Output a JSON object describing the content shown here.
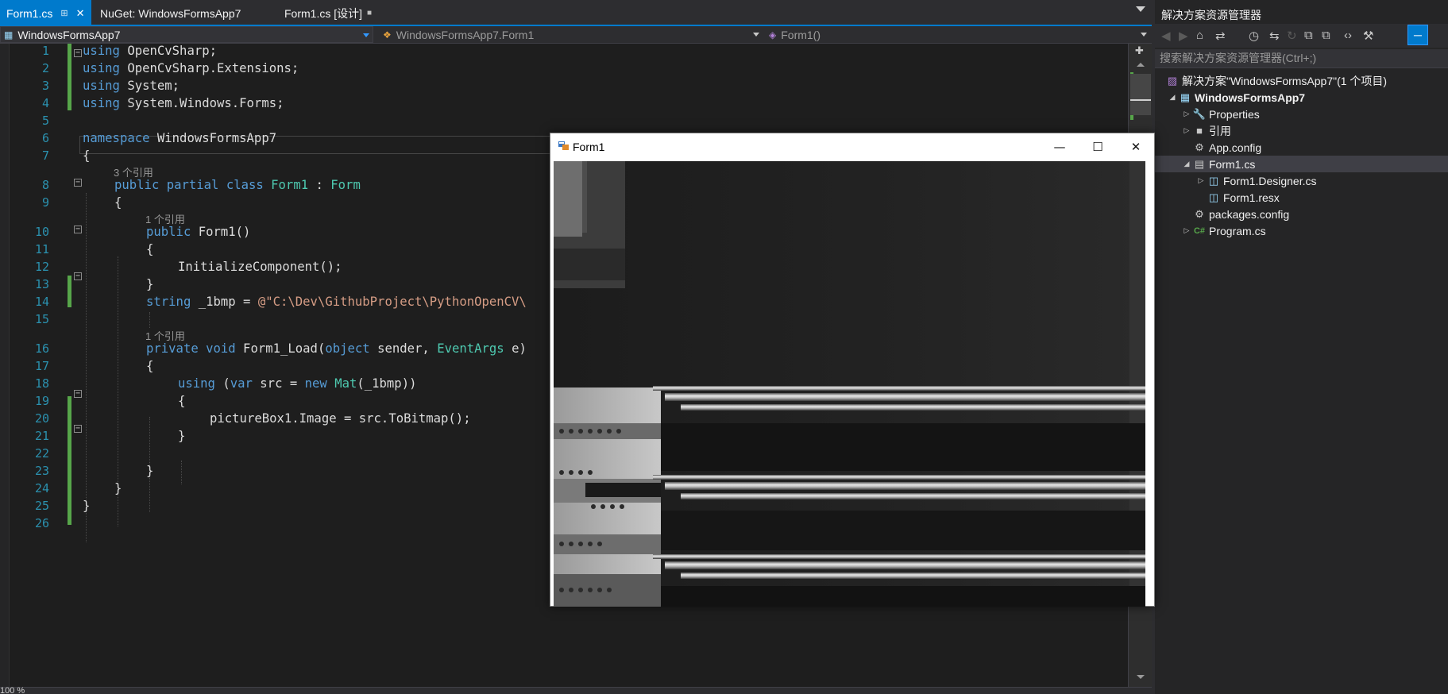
{
  "tabs": [
    {
      "label": "Form1.cs",
      "active": true,
      "pin": "⊞",
      "close": "✕",
      "pin2": "⊕"
    },
    {
      "label": "NuGet: WindowsFormsApp7",
      "active": false
    },
    {
      "label": "Form1.cs [设计]",
      "active": false,
      "lock": "🔒"
    }
  ],
  "navbar": {
    "project": "WindowsFormsApp7",
    "class": "WindowsFormsApp7.Form1",
    "member": "Form1()"
  },
  "editor": {
    "line_numbers": [
      "1",
      "2",
      "3",
      "4",
      "5",
      "6",
      "7",
      "8",
      "9",
      "10",
      "11",
      "12",
      "13",
      "14",
      "15",
      "16",
      "17",
      "18",
      "19",
      "20",
      "21",
      "22",
      "23",
      "24",
      "25",
      "26"
    ],
    "codelens": [
      "3 个引用",
      "1 个引用",
      "1 个引用"
    ],
    "lines": {
      "l1": {
        "kw": "using",
        "rest": " OpenCvSharp;"
      },
      "l2": {
        "kw": "using",
        "rest": " OpenCvSharp.Extensions;"
      },
      "l3": {
        "kw": "using",
        "rest": " System;"
      },
      "l4": {
        "kw": "using",
        "rest": " System.Windows.Forms;"
      },
      "l6": {
        "kw": "namespace",
        "rest": " WindowsFormsApp7"
      },
      "l7": {
        "text": "{"
      },
      "l8": {
        "kw": "public partial class",
        "sp": " ",
        "ty": "Form1",
        "mid": " : ",
        "ty2": "Form"
      },
      "l9": {
        "text": "{"
      },
      "l10": {
        "kw": "public",
        "rest": " Form1()"
      },
      "l11": {
        "text": "{"
      },
      "l12": {
        "text": "InitializeComponent();"
      },
      "l13": {
        "text": "}"
      },
      "l14": {
        "kw": "string",
        "rest": " _1bmp = ",
        "str": "@\"C:\\Dev\\GithubProject\\PythonOpenCV\\"
      },
      "l16": {
        "kw": "private void",
        "rest": " Form1_Load(",
        "kw2": "object",
        "rest2": " sender, ",
        "ty": "EventArgs",
        "rest3": " e)"
      },
      "l17": {
        "text": "{"
      },
      "l18": {
        "kw": "using",
        "rest": " (",
        "kw2": "var",
        "rest2": " src = ",
        "kw3": "new",
        "sp": " ",
        "ty": "Mat",
        "rest3": "(_1bmp))"
      },
      "l19": {
        "text": "{"
      },
      "l20": {
        "text": "pictureBox1.Image = src.ToBitmap();"
      },
      "l21": {
        "text": "}"
      },
      "l23": {
        "text": "}"
      },
      "l24": {
        "text": "}"
      },
      "l25": {
        "text": "}"
      }
    }
  },
  "statusbar": {
    "zoom": "100 %"
  },
  "solution_explorer": {
    "title": "解决方案资源管理器",
    "search_placeholder": "搜索解决方案资源管理器(Ctrl+;)",
    "toolbar_icons": [
      "back-icon",
      "forward-icon",
      "home-icon",
      "sync-icon",
      "history-icon",
      "switch-views-icon",
      "refresh-icon",
      "collapse-all-icon",
      "show-all-files-icon",
      "view-code-icon",
      "properties-icon",
      "preview-icon"
    ],
    "tree": [
      {
        "label": "解决方案\"WindowsFormsApp7\"(1 个项目)",
        "icon": "solution-icon"
      },
      {
        "label": "WindowsFormsApp7",
        "icon": "csharp-project-icon",
        "bold": true
      },
      {
        "label": "Properties",
        "icon": "wrench-icon"
      },
      {
        "label": "引用",
        "icon": "references-icon"
      },
      {
        "label": "App.config",
        "icon": "config-file-icon"
      },
      {
        "label": "Form1.cs",
        "icon": "form-icon",
        "selected": true
      },
      {
        "label": "Form1.Designer.cs",
        "icon": "cs-file-icon"
      },
      {
        "label": "Form1.resx",
        "icon": "resx-file-icon"
      },
      {
        "label": "packages.config",
        "icon": "config-file-icon"
      },
      {
        "label": "Program.cs",
        "icon": "cs-file-icon"
      }
    ]
  },
  "form_window": {
    "title": "Form1",
    "minimize": "—",
    "maximize": "☐",
    "close": "✕"
  },
  "colors": {
    "accent": "#007acc",
    "editor_bg": "#1e1e1e",
    "keyword": "#569cd6",
    "type": "#4ec9b0",
    "string": "#d69d85",
    "line_number": "#2b91af",
    "changed_bar": "#57a64a"
  }
}
